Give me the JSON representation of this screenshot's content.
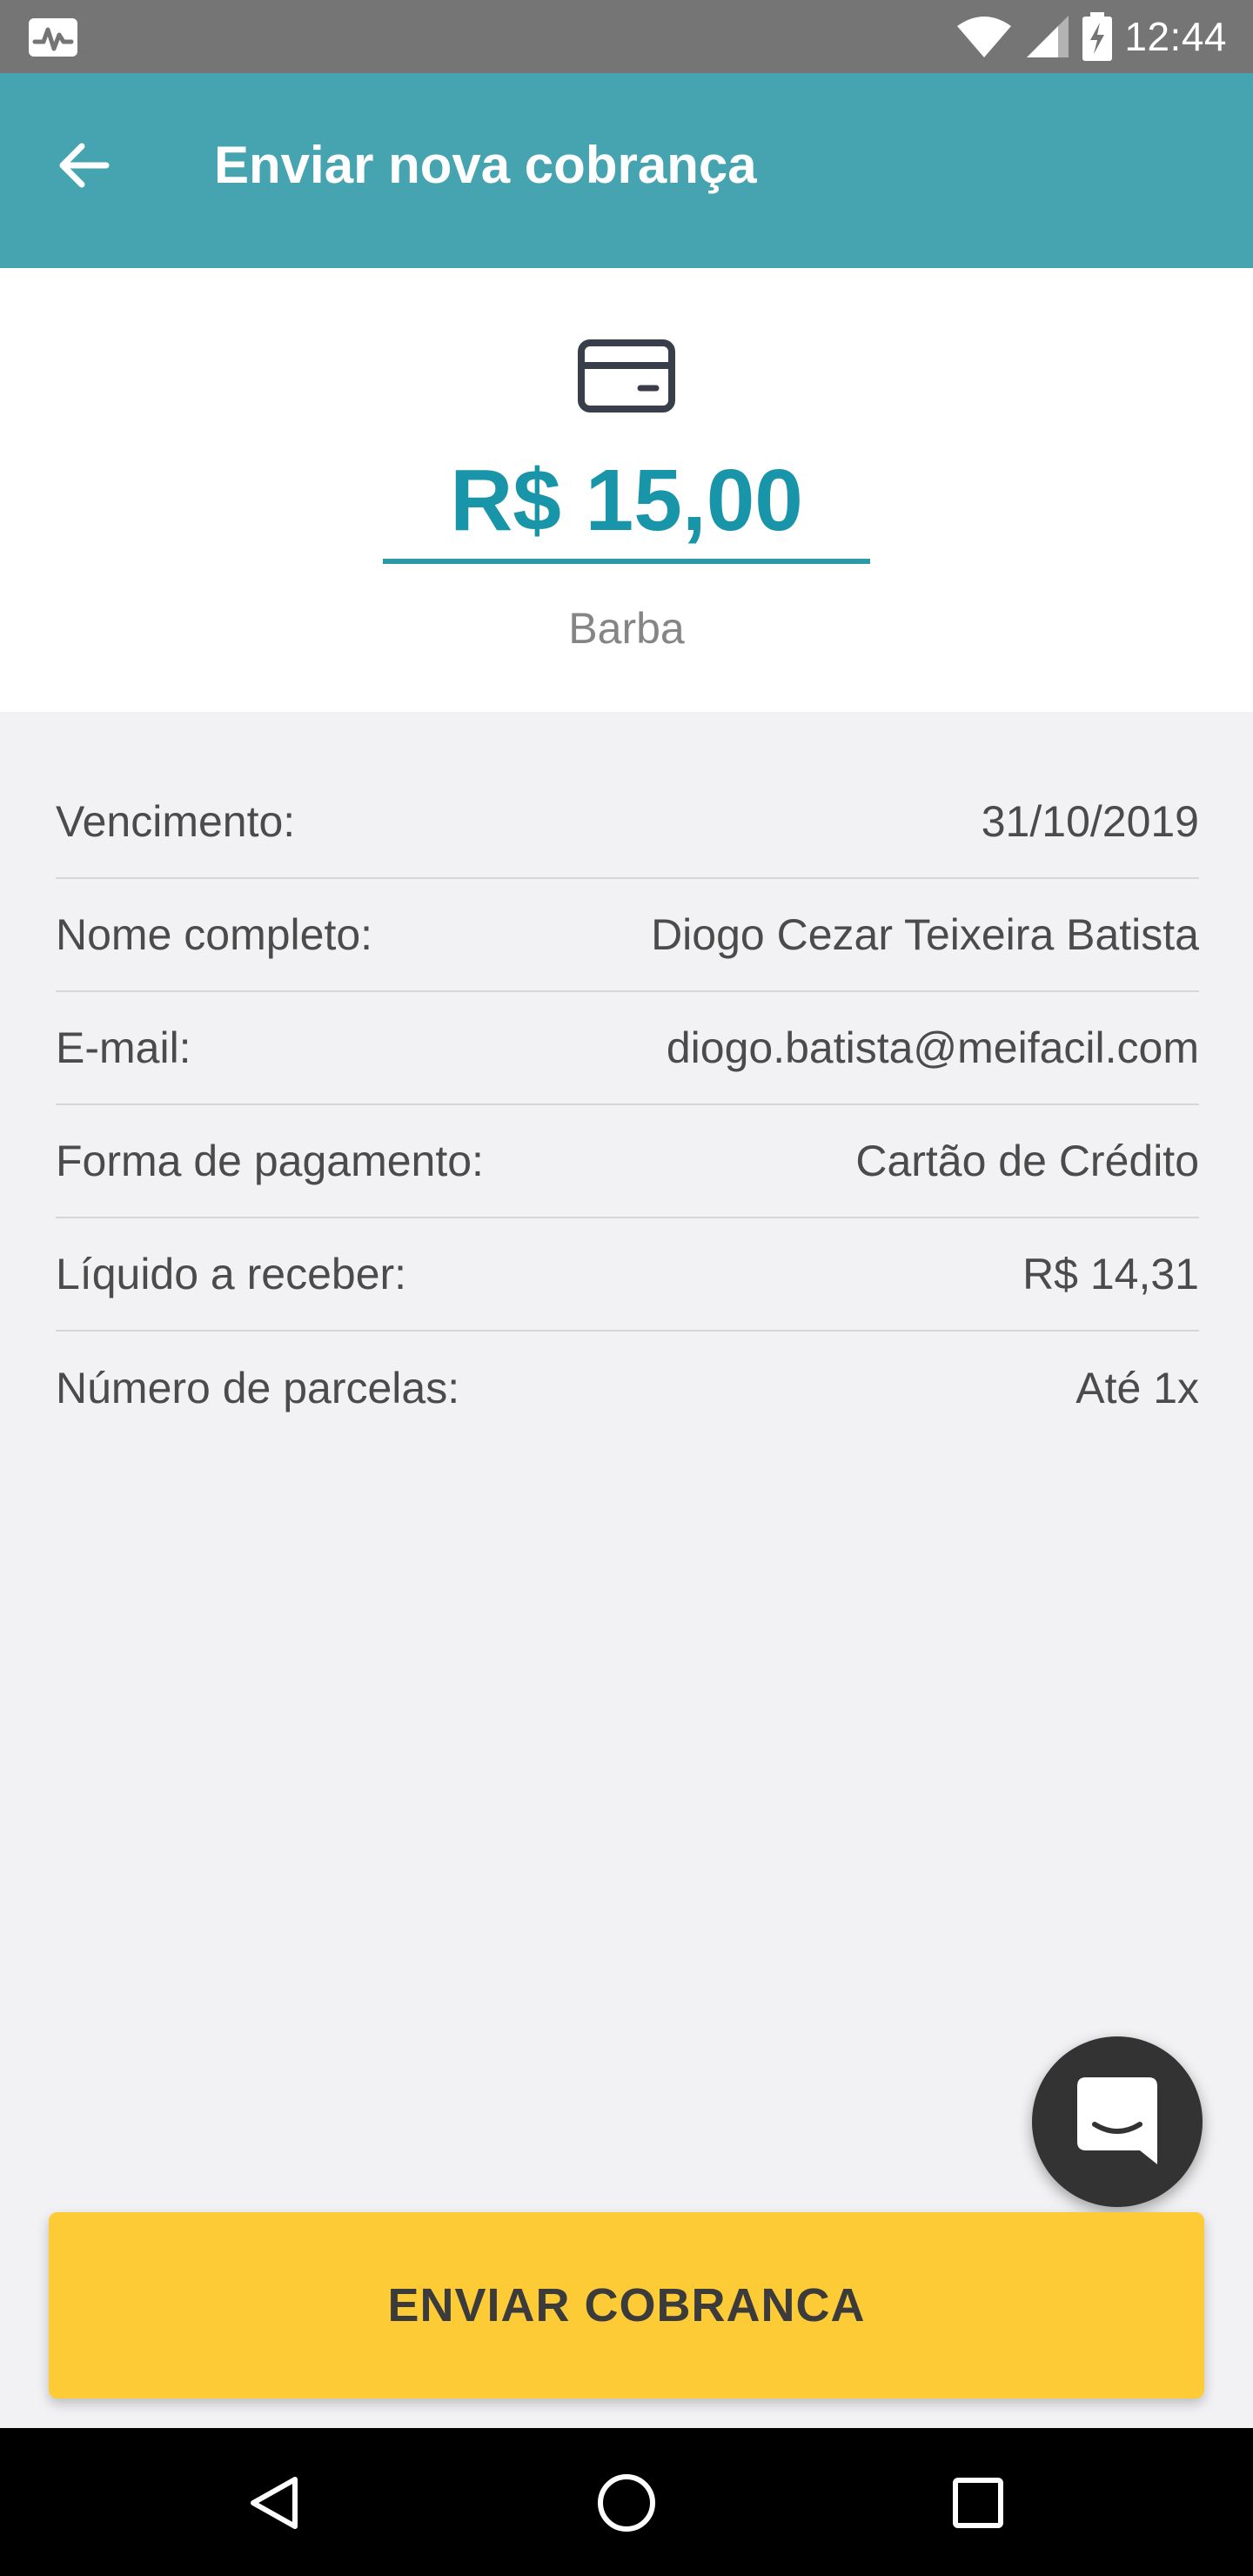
{
  "status_bar": {
    "time": "12:44"
  },
  "app_bar": {
    "title": "Enviar nova cobrança",
    "color": "#46a4b0"
  },
  "charge": {
    "amount": "R$ 15,00",
    "description": "Barba",
    "icon": "credit-card-icon"
  },
  "details": [
    {
      "label": "Vencimento:",
      "value": "31/10/2019"
    },
    {
      "label": "Nome completo:",
      "value": "Diogo Cezar Teixeira Batista"
    },
    {
      "label": "E-mail:",
      "value": "diogo.batista@meifacil.com"
    },
    {
      "label": "Forma de pagamento:",
      "value": "Cartão de Crédito"
    },
    {
      "label": "Líquido a receber:",
      "value": "R$ 14,31"
    },
    {
      "label": "Número de parcelas:",
      "value": "Até 1x"
    }
  ],
  "actions": {
    "send_label": "ENVIAR COBRANCA",
    "send_color": "#fdcb35"
  },
  "icons": {
    "back": "arrow-left-icon",
    "chat": "chat-bubble-icon",
    "nav_back": "triangle-back-icon",
    "nav_home": "circle-home-icon",
    "nav_recents": "square-recents-icon"
  }
}
